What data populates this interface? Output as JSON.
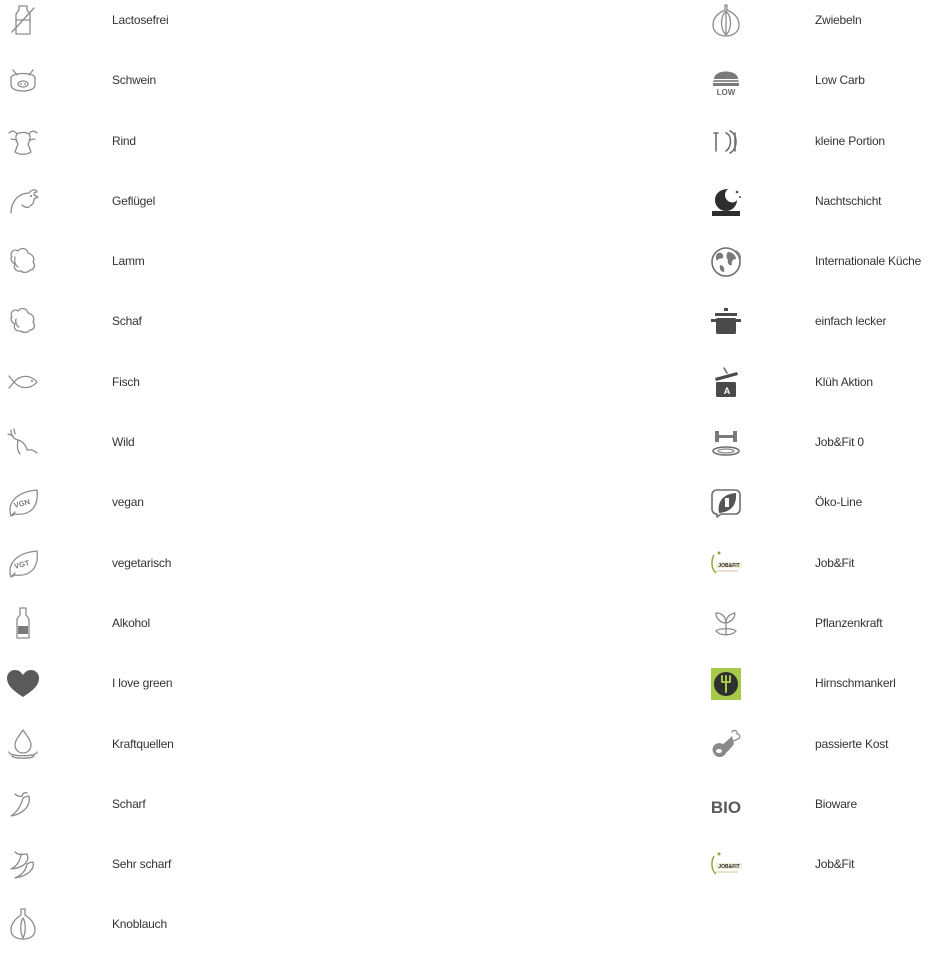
{
  "left_items": [
    {
      "label": "Lactosefrei",
      "icon": "lactose-free-icon"
    },
    {
      "label": "Schwein",
      "icon": "pig-icon"
    },
    {
      "label": "Rind",
      "icon": "cow-icon"
    },
    {
      "label": "Geflügel",
      "icon": "chicken-icon"
    },
    {
      "label": "Lamm",
      "icon": "lamb-icon"
    },
    {
      "label": "Schaf",
      "icon": "sheep-icon"
    },
    {
      "label": "Fisch",
      "icon": "fish-icon"
    },
    {
      "label": "Wild",
      "icon": "deer-icon"
    },
    {
      "label": "vegan",
      "icon": "vegan-leaf-icon",
      "badge": "VGN"
    },
    {
      "label": "vegetarisch",
      "icon": "vegetarian-leaf-icon",
      "badge": "VGT"
    },
    {
      "label": "Alkohol",
      "icon": "bottle-icon"
    },
    {
      "label": "I love green",
      "icon": "heart-icon"
    },
    {
      "label": "Kraftquellen",
      "icon": "water-drop-icon"
    },
    {
      "label": "Scharf",
      "icon": "chili-icon"
    },
    {
      "label": "Sehr scharf",
      "icon": "double-chili-icon"
    },
    {
      "label": "Knoblauch",
      "icon": "garlic-icon"
    }
  ],
  "right_items": [
    {
      "label": "Zwiebeln",
      "icon": "onion-icon"
    },
    {
      "label": "Low Carb",
      "icon": "low-carb-icon",
      "badge": "LOW"
    },
    {
      "label": "kleine Portion",
      "icon": "small-portion-icon"
    },
    {
      "label": "Nachtschicht",
      "icon": "night-shift-icon"
    },
    {
      "label": "Internationale Küche",
      "icon": "globe-icon"
    },
    {
      "label": "einfach lecker",
      "icon": "cooking-pot-icon"
    },
    {
      "label": "Klüh Aktion",
      "icon": "promo-pot-icon",
      "badge": "A"
    },
    {
      "label": "Job&Fit 0",
      "icon": "dumbbell-plate-icon"
    },
    {
      "label": "Öko-Line",
      "icon": "eco-line-icon"
    },
    {
      "label": "Job&Fit",
      "icon": "job-fit-logo-icon",
      "badge": "JOB&FIT"
    },
    {
      "label": "Pflanzenkraft",
      "icon": "plant-power-icon"
    },
    {
      "label": "Hirnschmankerl",
      "icon": "brain-food-icon"
    },
    {
      "label": "passierte Kost",
      "icon": "drumstick-icon"
    },
    {
      "label": "Bioware",
      "icon": "bio-icon",
      "badge": "BIO"
    },
    {
      "label": "Job&Fit",
      "icon": "job-fit-logo-icon",
      "badge": "JOB&FIT"
    }
  ]
}
